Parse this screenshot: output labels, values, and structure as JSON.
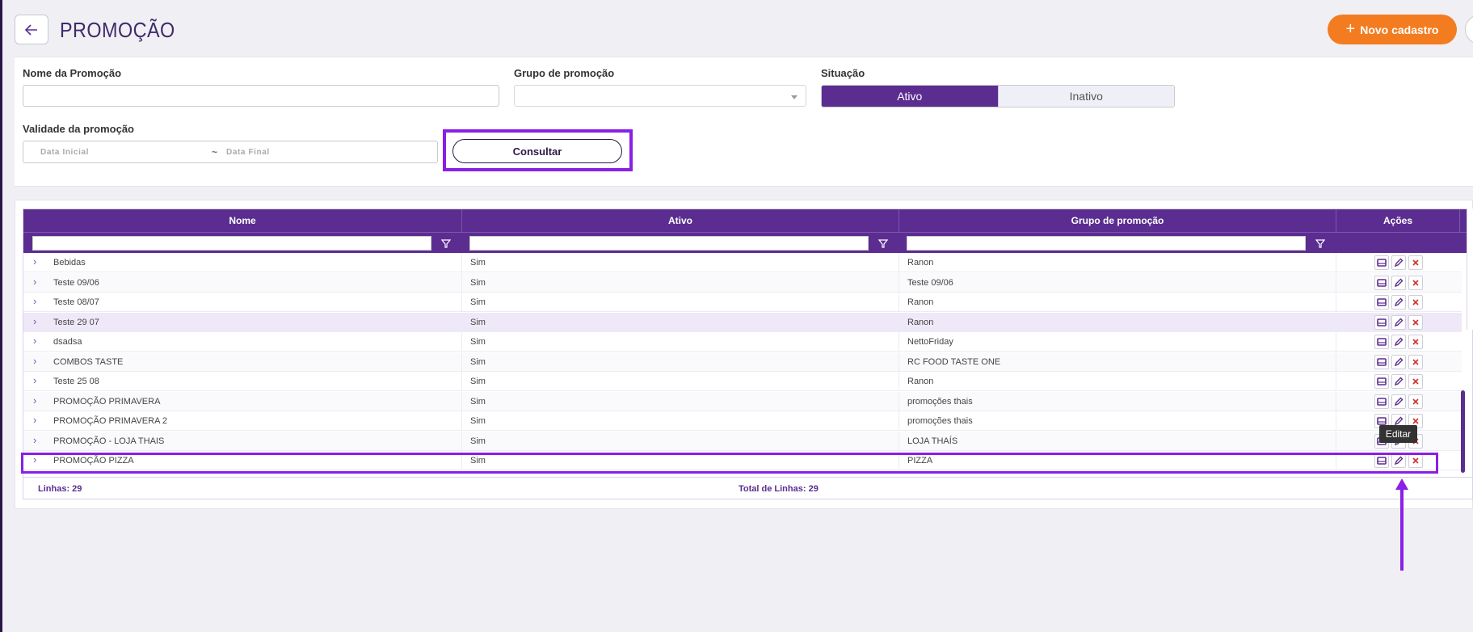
{
  "header": {
    "title": "PROMOÇÃO",
    "new_button": "Novo cadastro"
  },
  "filters": {
    "nome_label": "Nome da Promoção",
    "nome_value": "",
    "grupo_label": "Grupo de promoção",
    "situacao_label": "Situação",
    "situacao_options": [
      "Ativo",
      "Inativo"
    ],
    "situacao_selected": "Ativo",
    "validade_label": "Validade da promoção",
    "data_inicial_placeholder": "Data Inicial",
    "data_separator": "~",
    "data_final_placeholder": "Data Final",
    "consultar_label": "Consultar"
  },
  "grid": {
    "columns": [
      "Nome",
      "Ativo",
      "Grupo de promoção",
      "Ações"
    ],
    "rows": [
      {
        "nome": "Bebidas",
        "ativo": "Sim",
        "grupo": "Ranon"
      },
      {
        "nome": "Teste 09/06",
        "ativo": "Sim",
        "grupo": "Teste 09/06"
      },
      {
        "nome": "Teste 08/07",
        "ativo": "Sim",
        "grupo": "Ranon"
      },
      {
        "nome": "Teste 29 07",
        "ativo": "Sim",
        "grupo": "Ranon"
      },
      {
        "nome": "dsadsa",
        "ativo": "Sim",
        "grupo": "NettoFriday"
      },
      {
        "nome": "COMBOS TASTE",
        "ativo": "Sim",
        "grupo": "RC FOOD TASTE ONE"
      },
      {
        "nome": "Teste 25 08",
        "ativo": "Sim",
        "grupo": "Ranon"
      },
      {
        "nome": "PROMOÇÃO PRIMAVERA",
        "ativo": "Sim",
        "grupo": "promoções thais"
      },
      {
        "nome": "PROMOÇÃO PRIMAVERA 2",
        "ativo": "Sim",
        "grupo": "promoções thais"
      },
      {
        "nome": "PROMOÇÃO - LOJA THAIS",
        "ativo": "Sim",
        "grupo": "LOJA THAÍS"
      },
      {
        "nome": "PROMOÇÃO PIZZA",
        "ativo": "Sim",
        "grupo": "PIZZA"
      }
    ],
    "footer_left": "Linhas: 29",
    "footer_center": "Total de Linhas: 29",
    "tooltip": "Editar"
  },
  "colors": {
    "primary": "#5b2d91",
    "accent": "#f47c20",
    "highlight": "#8a1fe6",
    "delete": "#d0312d"
  },
  "icons": [
    "back-arrow-icon",
    "plus-icon",
    "chevron-down-icon",
    "filter-icon",
    "expand-icon",
    "view-icon",
    "edit-icon",
    "delete-icon"
  ]
}
